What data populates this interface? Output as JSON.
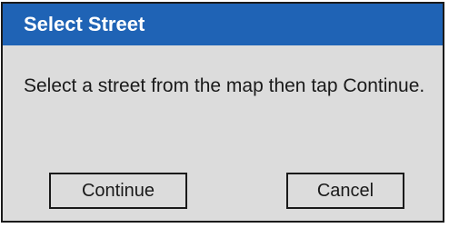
{
  "dialog": {
    "title": "Select Street",
    "message": "Select a street from the map then tap Continue.",
    "buttons": {
      "continue_label": "Continue",
      "cancel_label": "Cancel"
    }
  },
  "colors": {
    "title_bar": "#1f63b5",
    "title_text": "#ffffff",
    "body_bg": "#dcdcdc",
    "border": "#1a1a1a"
  }
}
